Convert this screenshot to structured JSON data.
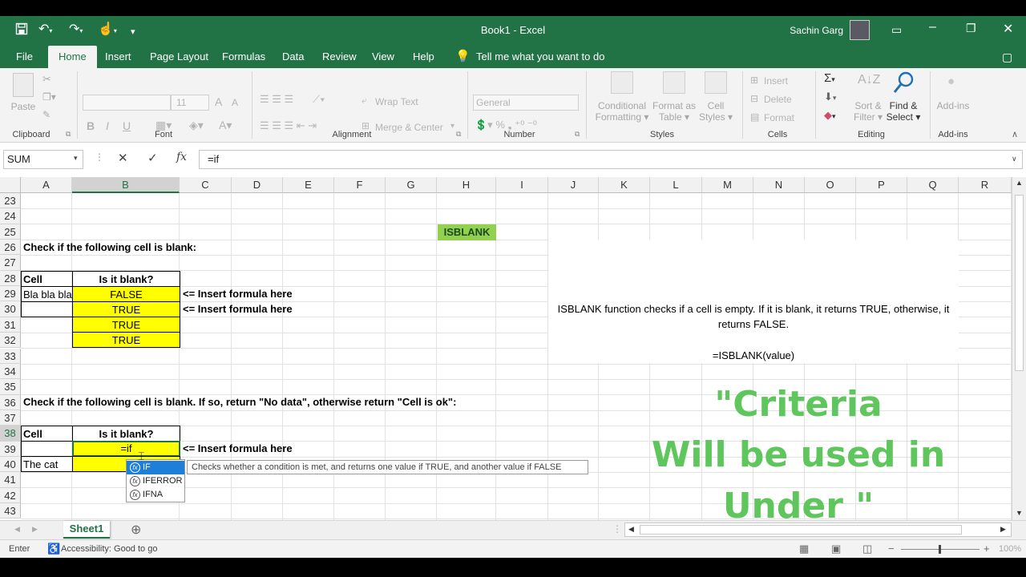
{
  "window": {
    "title": "Book1  -  Excel",
    "user": "Sachin Garg"
  },
  "tabs": [
    "File",
    "Home",
    "Insert",
    "Page Layout",
    "Formulas",
    "Data",
    "Review",
    "View",
    "Help"
  ],
  "tell_me": "Tell me what you want to do",
  "ribbon": {
    "clipboard": {
      "paste": "Paste",
      "label": "Clipboard"
    },
    "font": {
      "size": "11",
      "bold": "B",
      "italic": "I",
      "underline": "U",
      "label": "Font"
    },
    "alignment": {
      "wrap": "Wrap Text",
      "merge": "Merge & Center",
      "label": "Alignment"
    },
    "number": {
      "format": "General",
      "label": "Number"
    },
    "styles": {
      "cond1": "Conditional",
      "cond2": "Formatting",
      "fmt1": "Format as",
      "fmt2": "Table",
      "cell1": "Cell",
      "cell2": "Styles",
      "label": "Styles"
    },
    "cells": {
      "insert": "Insert",
      "delete": "Delete",
      "format": "Format",
      "label": "Cells"
    },
    "editing": {
      "sort1": "Sort &",
      "sort2": "Filter",
      "find1": "Find &",
      "find2": "Select",
      "label": "Editing"
    },
    "addins": {
      "btn": "Add-ins",
      "label": "Add-ins"
    }
  },
  "formula_bar": {
    "name_box": "SUM",
    "formula": "=if"
  },
  "columns": [
    "A",
    "B",
    "C",
    "D",
    "E",
    "F",
    "G",
    "H",
    "I",
    "J",
    "K",
    "L",
    "M",
    "N",
    "O",
    "P",
    "Q",
    "R"
  ],
  "rows": [
    "23",
    "24",
    "25",
    "26",
    "27",
    "28",
    "29",
    "30",
    "31",
    "32",
    "33",
    "34",
    "35",
    "36",
    "37",
    "38",
    "39",
    "40",
    "41",
    "42",
    "43"
  ],
  "cells": {
    "h24": "ISBLANK",
    "a25": "Check if the following cell is blank:",
    "a27": "Cell",
    "b27": "Is it blank?",
    "a28": "Bla bla bla",
    "b28": "FALSE",
    "c28": "<= Insert formula here",
    "b29": "TRUE",
    "c29": "<= Insert formula here",
    "b30": "TRUE",
    "b31": "TRUE",
    "a35": "Check if the following cell is blank. If so, return \"No data\", otherwise return \"Cell is ok\":",
    "a37": "Cell",
    "b37": "Is it blank?",
    "b38": "=if",
    "c38": "<= Insert formula here",
    "a39": "The cat"
  },
  "note": {
    "line1": "ISBLANK function checks if a cell is empty. If it is blank, it returns TRUE, otherwise, it",
    "line2": "returns FALSE.",
    "line3": "=ISBLANK(value)"
  },
  "autocomplete": {
    "items": [
      "IF",
      "IFERROR",
      "IFNA"
    ],
    "tooltip": "Checks whether a condition is met, and returns one value if TRUE, and another value if FALSE"
  },
  "overlay": {
    "line1": "\"Criteria",
    "line2": "Will be used in",
    "line3": "Under \""
  },
  "sheet_tab": "Sheet1",
  "status": {
    "mode": "Enter",
    "accessibility": "Accessibility: Good to go",
    "zoom": "100%"
  },
  "colors": {
    "excel_green": "#217346",
    "highlight": "#ffff00",
    "isblank_bg": "#92d050",
    "overlay_text": "#5ec65c"
  }
}
